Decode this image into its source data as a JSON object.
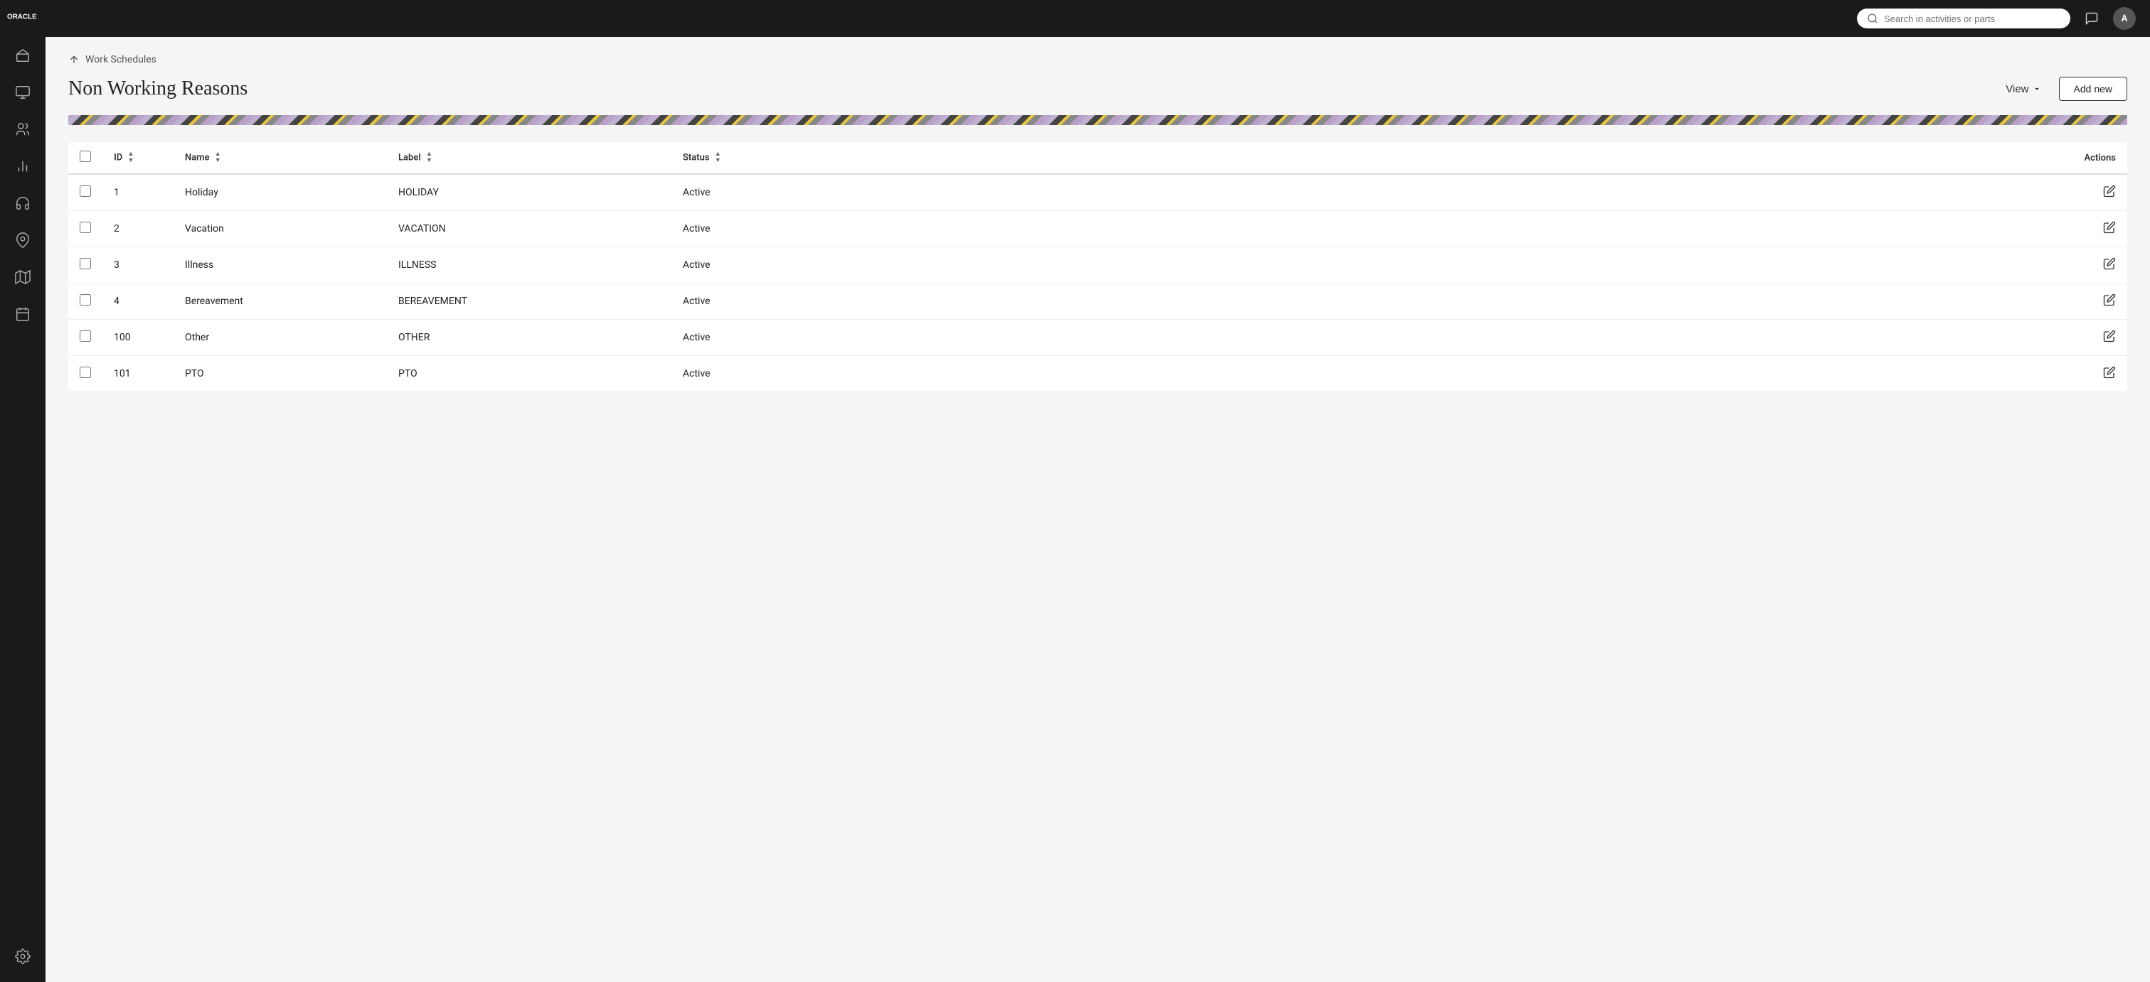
{
  "app": {
    "logo_text": "ORACLE"
  },
  "topbar": {
    "search_placeholder": "Search in activities or parts",
    "avatar_text": "A"
  },
  "breadcrumb": {
    "label": "Work Schedules"
  },
  "page": {
    "title": "Non Working Reasons",
    "view_label": "View",
    "add_new_label": "Add new"
  },
  "table": {
    "columns": [
      {
        "key": "checkbox",
        "label": ""
      },
      {
        "key": "id",
        "label": "ID"
      },
      {
        "key": "name",
        "label": "Name"
      },
      {
        "key": "label",
        "label": "Label"
      },
      {
        "key": "status",
        "label": "Status"
      },
      {
        "key": "actions",
        "label": "Actions"
      }
    ],
    "rows": [
      {
        "id": "1",
        "name": "Holiday",
        "label": "HOLIDAY",
        "status": "Active"
      },
      {
        "id": "2",
        "name": "Vacation",
        "label": "VACATION",
        "status": "Active"
      },
      {
        "id": "3",
        "name": "Illness",
        "label": "ILLNESS",
        "status": "Active"
      },
      {
        "id": "4",
        "name": "Bereavement",
        "label": "BEREAVEMENT",
        "status": "Active"
      },
      {
        "id": "100",
        "name": "Other",
        "label": "OTHER",
        "status": "Active"
      },
      {
        "id": "101",
        "name": "PTO",
        "label": "PTO",
        "status": "Active"
      }
    ]
  },
  "sidebar": {
    "items": [
      {
        "name": "home-icon",
        "label": "Home"
      },
      {
        "name": "monitor-icon",
        "label": "Monitor"
      },
      {
        "name": "users-icon",
        "label": "Users"
      },
      {
        "name": "chart-icon",
        "label": "Analytics"
      },
      {
        "name": "headset-icon",
        "label": "Support"
      },
      {
        "name": "location-icon",
        "label": "Location"
      },
      {
        "name": "map-icon",
        "label": "Map"
      },
      {
        "name": "calendar-icon",
        "label": "Calendar"
      }
    ],
    "bottom_items": [
      {
        "name": "settings-icon",
        "label": "Settings"
      }
    ]
  }
}
